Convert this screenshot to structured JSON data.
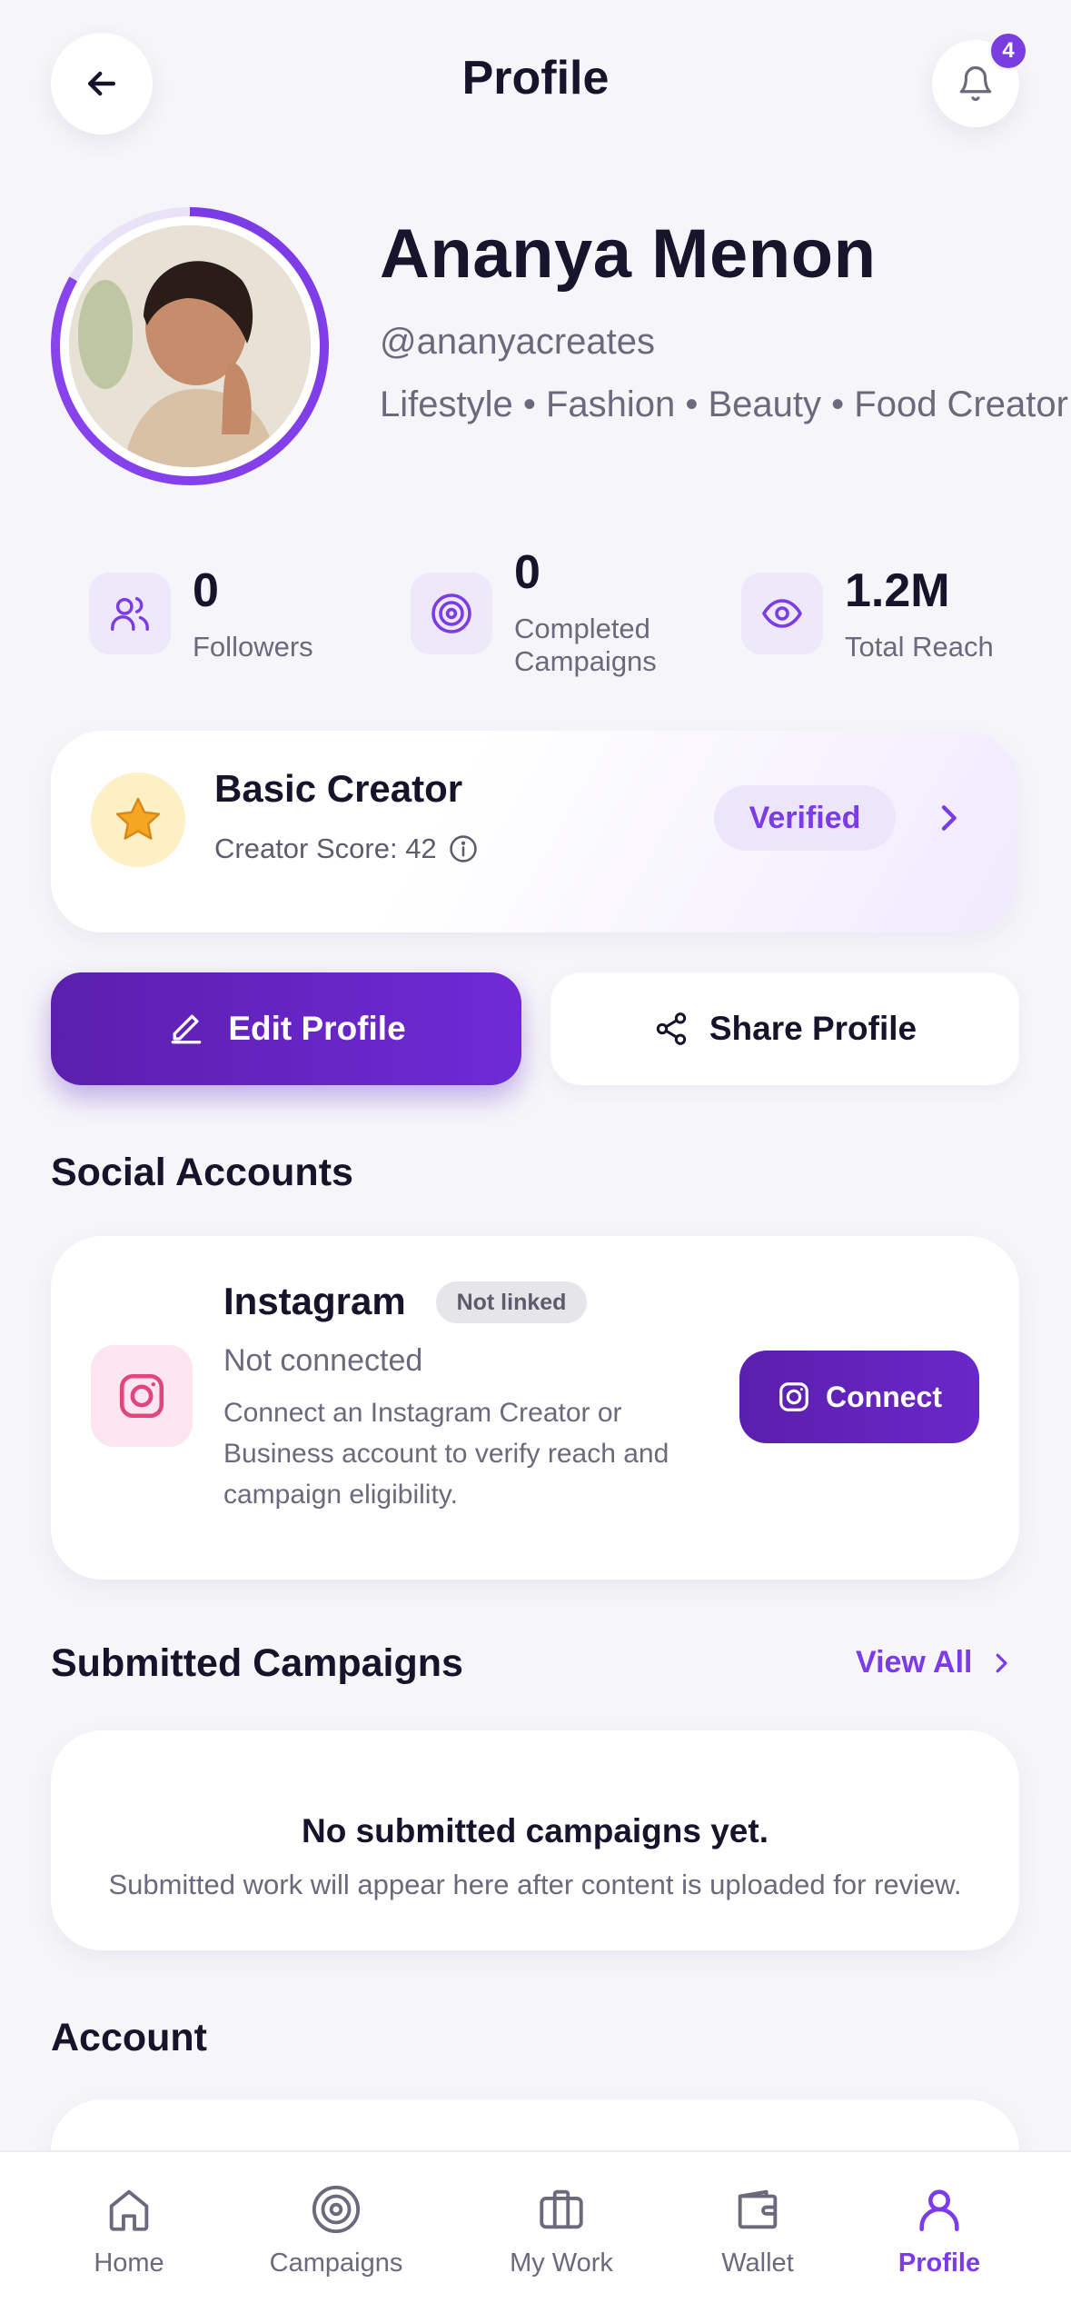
{
  "header": {
    "title": "Profile",
    "notification_count": "4"
  },
  "profile": {
    "name": "Ananya Menon",
    "handle": "@ananyacreates",
    "niches": "Lifestyle • Fashion • Beauty • Food Creator"
  },
  "stats": [
    {
      "value": "0",
      "label": "Followers",
      "icon": "users-icon"
    },
    {
      "value": "0",
      "label": "Completed Campaigns",
      "icon": "target-icon"
    },
    {
      "value": "1.2M",
      "label": "Total Reach",
      "icon": "eye-icon"
    }
  ],
  "tier": {
    "title": "Basic Creator",
    "score_label": "Creator Score: 42",
    "status": "Verified"
  },
  "actions": {
    "edit": "Edit Profile",
    "share": "Share Profile"
  },
  "social": {
    "section_title": "Social Accounts",
    "platform": "Instagram",
    "link_status": "Not linked",
    "connection": "Not connected",
    "description": "Connect an Instagram Creator or Business account to verify reach and campaign eligibility.",
    "connect_label": "Connect"
  },
  "campaigns": {
    "section_title": "Submitted Campaigns",
    "view_all": "View All",
    "empty_title": "No submitted campaigns yet.",
    "empty_sub": "Submitted work will appear here after content is uploaded for review."
  },
  "account": {
    "section_title": "Account"
  },
  "nav": {
    "items": [
      {
        "label": "Home",
        "icon": "home-icon"
      },
      {
        "label": "Campaigns",
        "icon": "target-icon"
      },
      {
        "label": "My Work",
        "icon": "briefcase-icon"
      },
      {
        "label": "Wallet",
        "icon": "wallet-icon"
      },
      {
        "label": "Profile",
        "icon": "user-icon"
      }
    ],
    "active": "Profile"
  },
  "colors": {
    "accent": "#7b3be6",
    "primary_button": "#5b1fad",
    "background": "#f6f6fa"
  }
}
